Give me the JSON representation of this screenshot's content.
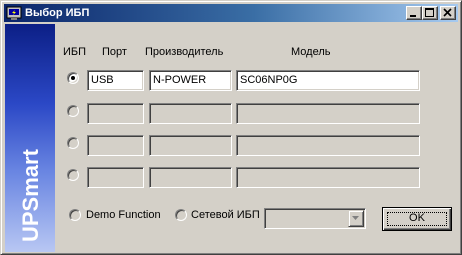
{
  "window": {
    "title": "Выбор ИБП",
    "app_icon": "ups-app-icon",
    "controls": [
      "minimize-icon",
      "maximize-icon",
      "close-icon"
    ]
  },
  "sidebar": {
    "brand": "UPSmart"
  },
  "headers": {
    "ups": "ИБП",
    "port": "Порт",
    "manufacturer": "Производитель",
    "model": "Модель"
  },
  "rows": [
    {
      "selected": true,
      "enabled": true,
      "port": "USB",
      "manufacturer": "N-POWER",
      "model": "SC06NP0G"
    },
    {
      "selected": false,
      "enabled": false,
      "port": "",
      "manufacturer": "",
      "model": ""
    },
    {
      "selected": false,
      "enabled": false,
      "port": "",
      "manufacturer": "",
      "model": ""
    },
    {
      "selected": false,
      "enabled": false,
      "port": "",
      "manufacturer": "",
      "model": ""
    }
  ],
  "footer": {
    "demo_label": "Demo Function",
    "network_label": "Сетевой ИБП",
    "network_value": "",
    "ok_label": "OK"
  }
}
